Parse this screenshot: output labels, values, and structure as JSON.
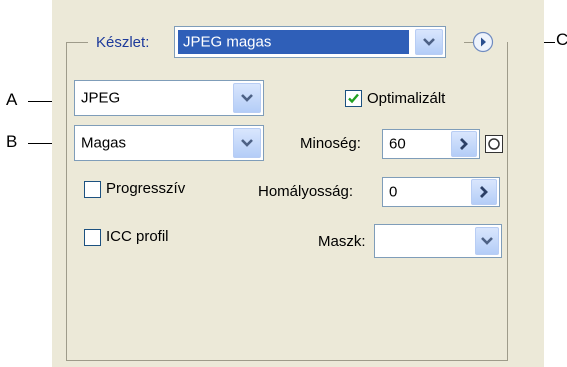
{
  "callouts": {
    "a": "A",
    "b": "B",
    "c": "C"
  },
  "preset": {
    "label": "Készlet:",
    "value": "JPEG magas"
  },
  "format": {
    "value": "JPEG"
  },
  "quality_preset": {
    "value": "Magas"
  },
  "optimized": {
    "label": "Optimalizált",
    "checked": true
  },
  "quality": {
    "label": "Minoség:",
    "value": "60"
  },
  "blur": {
    "label": "Homályosság:",
    "value": "0"
  },
  "progressive": {
    "label": "Progresszív",
    "checked": false
  },
  "icc": {
    "label": "ICC profil",
    "checked": false
  },
  "matte": {
    "label": "Maszk:",
    "value": ""
  },
  "colors": {
    "panel_bg": "#ece9d8",
    "selection": "#2f5fb8",
    "label_blue": "#1d3a9b",
    "check_green": "#21a121"
  }
}
